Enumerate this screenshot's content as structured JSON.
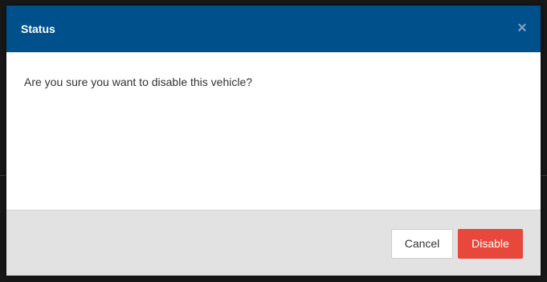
{
  "dialog": {
    "title": "Status",
    "close_glyph": "×",
    "message": "Are you sure you want to disable this vehicle?",
    "buttons": {
      "cancel_label": "Cancel",
      "disable_label": "Disable"
    }
  },
  "colors": {
    "header": "#00508c",
    "danger": "#e8483b",
    "footer": "#e2e2e2"
  },
  "icons": {
    "close": "close-icon"
  }
}
